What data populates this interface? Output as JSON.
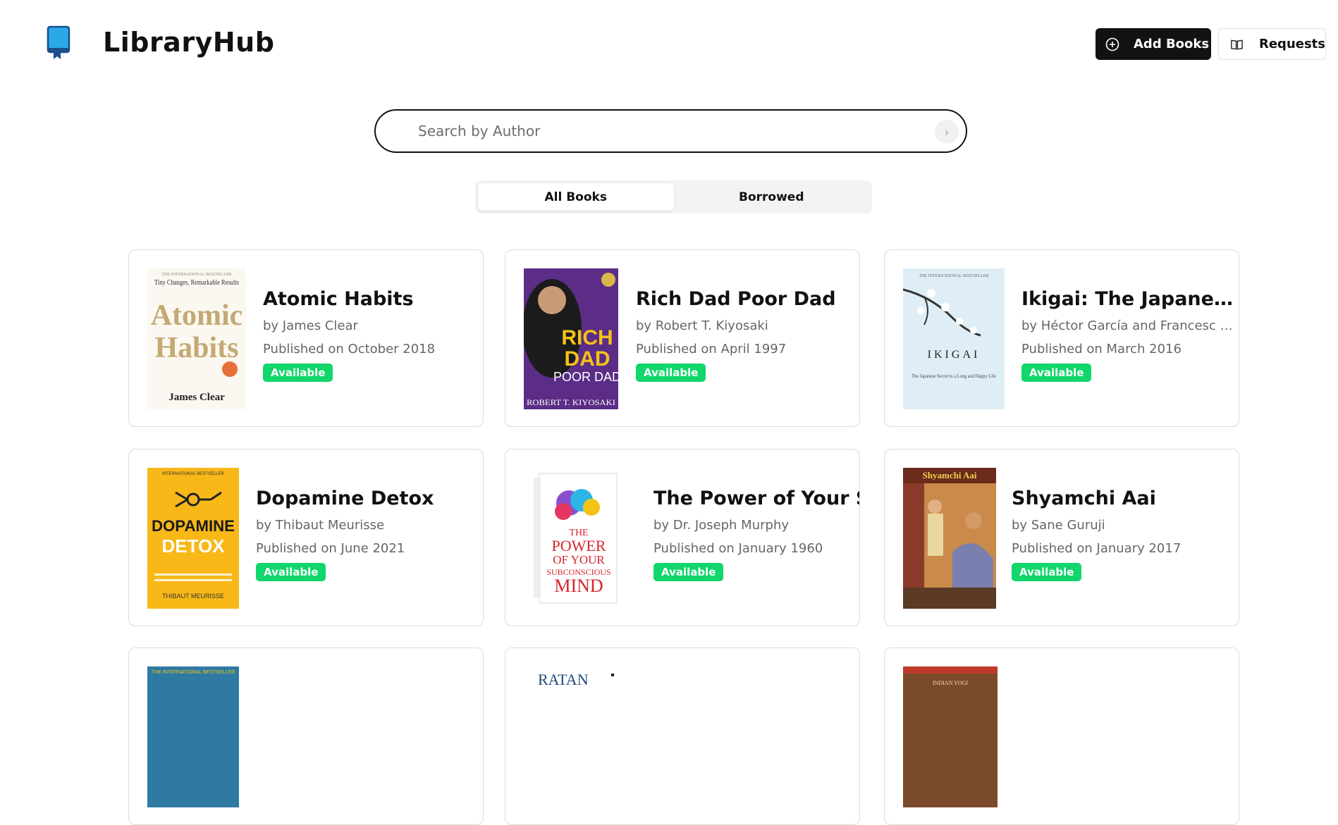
{
  "app": {
    "title": "LibraryHub"
  },
  "header": {
    "add_books_label": "Add Books",
    "requests_label": "Requests"
  },
  "search": {
    "placeholder": "Search by Author",
    "value": ""
  },
  "tabs": [
    {
      "label": "All Books",
      "active": true
    },
    {
      "label": "Borrowed",
      "active": false
    }
  ],
  "books": [
    {
      "title": "Atomic Habits",
      "author": "by James Clear",
      "published": "Published on October 2018",
      "status": "Available"
    },
    {
      "title": "Rich Dad Poor Dad",
      "author": "by Robert T. Kiyosaki",
      "published": "Published on April 1997",
      "status": "Available"
    },
    {
      "title": "Ikigai: The Japanese Secret to a Long and Happy Life",
      "author": "by Héctor García and Francesc Miralles",
      "published": "Published on March 2016",
      "status": "Available"
    },
    {
      "title": "Dopamine Detox",
      "author": "by Thibaut Meurisse",
      "published": "Published on June 2021",
      "status": "Available"
    },
    {
      "title": "The Power of Your Subconscious Mind",
      "author": "by Dr. Joseph Murphy",
      "published": "Published on January 1960",
      "status": "Available"
    },
    {
      "title": "Shyamchi Aai",
      "author": "by Sane Guruji",
      "published": "Published on January 2017",
      "status": "Available"
    }
  ],
  "covers": {
    "atomic": {
      "top": "THE INTERNATIONAL BESTSELLER",
      "tag": "Tiny Changes, Remarkable Results",
      "w1": "Atomic",
      "w2": "Habits",
      "author": "James Clear"
    },
    "richdad": {
      "w1": "RICH",
      "w2": "DAD",
      "w3": "POOR DAD",
      "author": "ROBERT T. KIYOSAKI"
    },
    "ikigai": {
      "top": "THE INTERNATIONAL BESTSELLER",
      "title": "IKIGAI",
      "sub": "The Japanese Secret to a Long and Happy Life"
    },
    "dopamine": {
      "top": "INTERNATIONAL BESTSELLER",
      "w1": "DOPAMINE",
      "w2": "DETOX",
      "author": "THIBAUT MEURISSE"
    },
    "power": {
      "w1": "THE",
      "w2": "POWER",
      "w3": "OF YOUR",
      "w4": "SUBCONSCIOUS",
      "w5": "MIND"
    },
    "shyamchi": {
      "title": "Shyamchi Aai"
    },
    "peek1": {
      "top": "THE INTERNATIONAL BESTSELLER"
    },
    "peek2": {
      "title": "RATAN"
    },
    "peek3": {
      "top": "INDIAN YOGI"
    }
  },
  "colors": {
    "primary_button": "#121212",
    "available_badge": "#10d66b",
    "logo": "#2aa9e8"
  }
}
